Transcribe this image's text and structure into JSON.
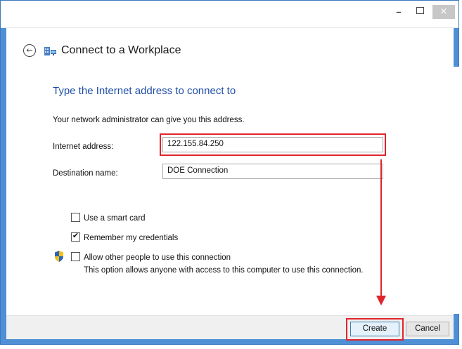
{
  "window": {
    "title": "Connect to a Workplace",
    "controls": {
      "minimize": "–",
      "maximize": "□",
      "close": "×"
    },
    "back_icon": "back-arrow-icon",
    "app_icon": "workplace-network-icon"
  },
  "page": {
    "heading": "Type the Internet address to connect to",
    "intro": "Your network administrator can give you this address.",
    "fields": {
      "internet_address_label": "Internet address:",
      "internet_address_value": "122.155.84.250",
      "destination_name_label": "Destination name:",
      "destination_name_value": "DOE Connection"
    },
    "options": [
      {
        "label": "Use a smart card",
        "checked": false
      },
      {
        "label": "Remember my credentials",
        "checked": true
      },
      {
        "label": "Allow other people to use this connection",
        "checked": false
      }
    ],
    "shield_icon": "uac-shield-icon",
    "allow_note": "This option allows anyone with access to this computer to use this connection."
  },
  "footer": {
    "create_label": "Create",
    "cancel_label": "Cancel"
  },
  "annotations": {
    "highlight_color": "#e0242c"
  }
}
